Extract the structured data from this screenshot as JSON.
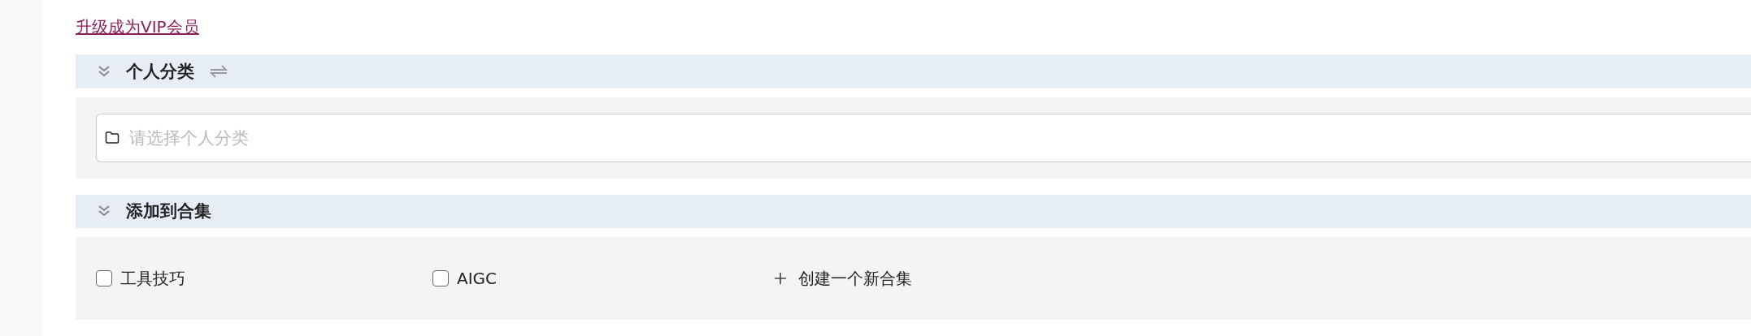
{
  "upgrade_link": "升级成为VIP会员",
  "sections": [
    {
      "kind": "select",
      "title": "个人分类",
      "expanded": true,
      "field": {
        "placeholder": "请选择个人分类"
      }
    },
    {
      "kind": "checklist",
      "title": "添加到合集",
      "expanded": true,
      "options": [
        {
          "label": "工具技巧",
          "checked": false
        },
        {
          "label": "AIGC",
          "checked": false
        }
      ],
      "create_action": "创建一个新合集"
    }
  ]
}
